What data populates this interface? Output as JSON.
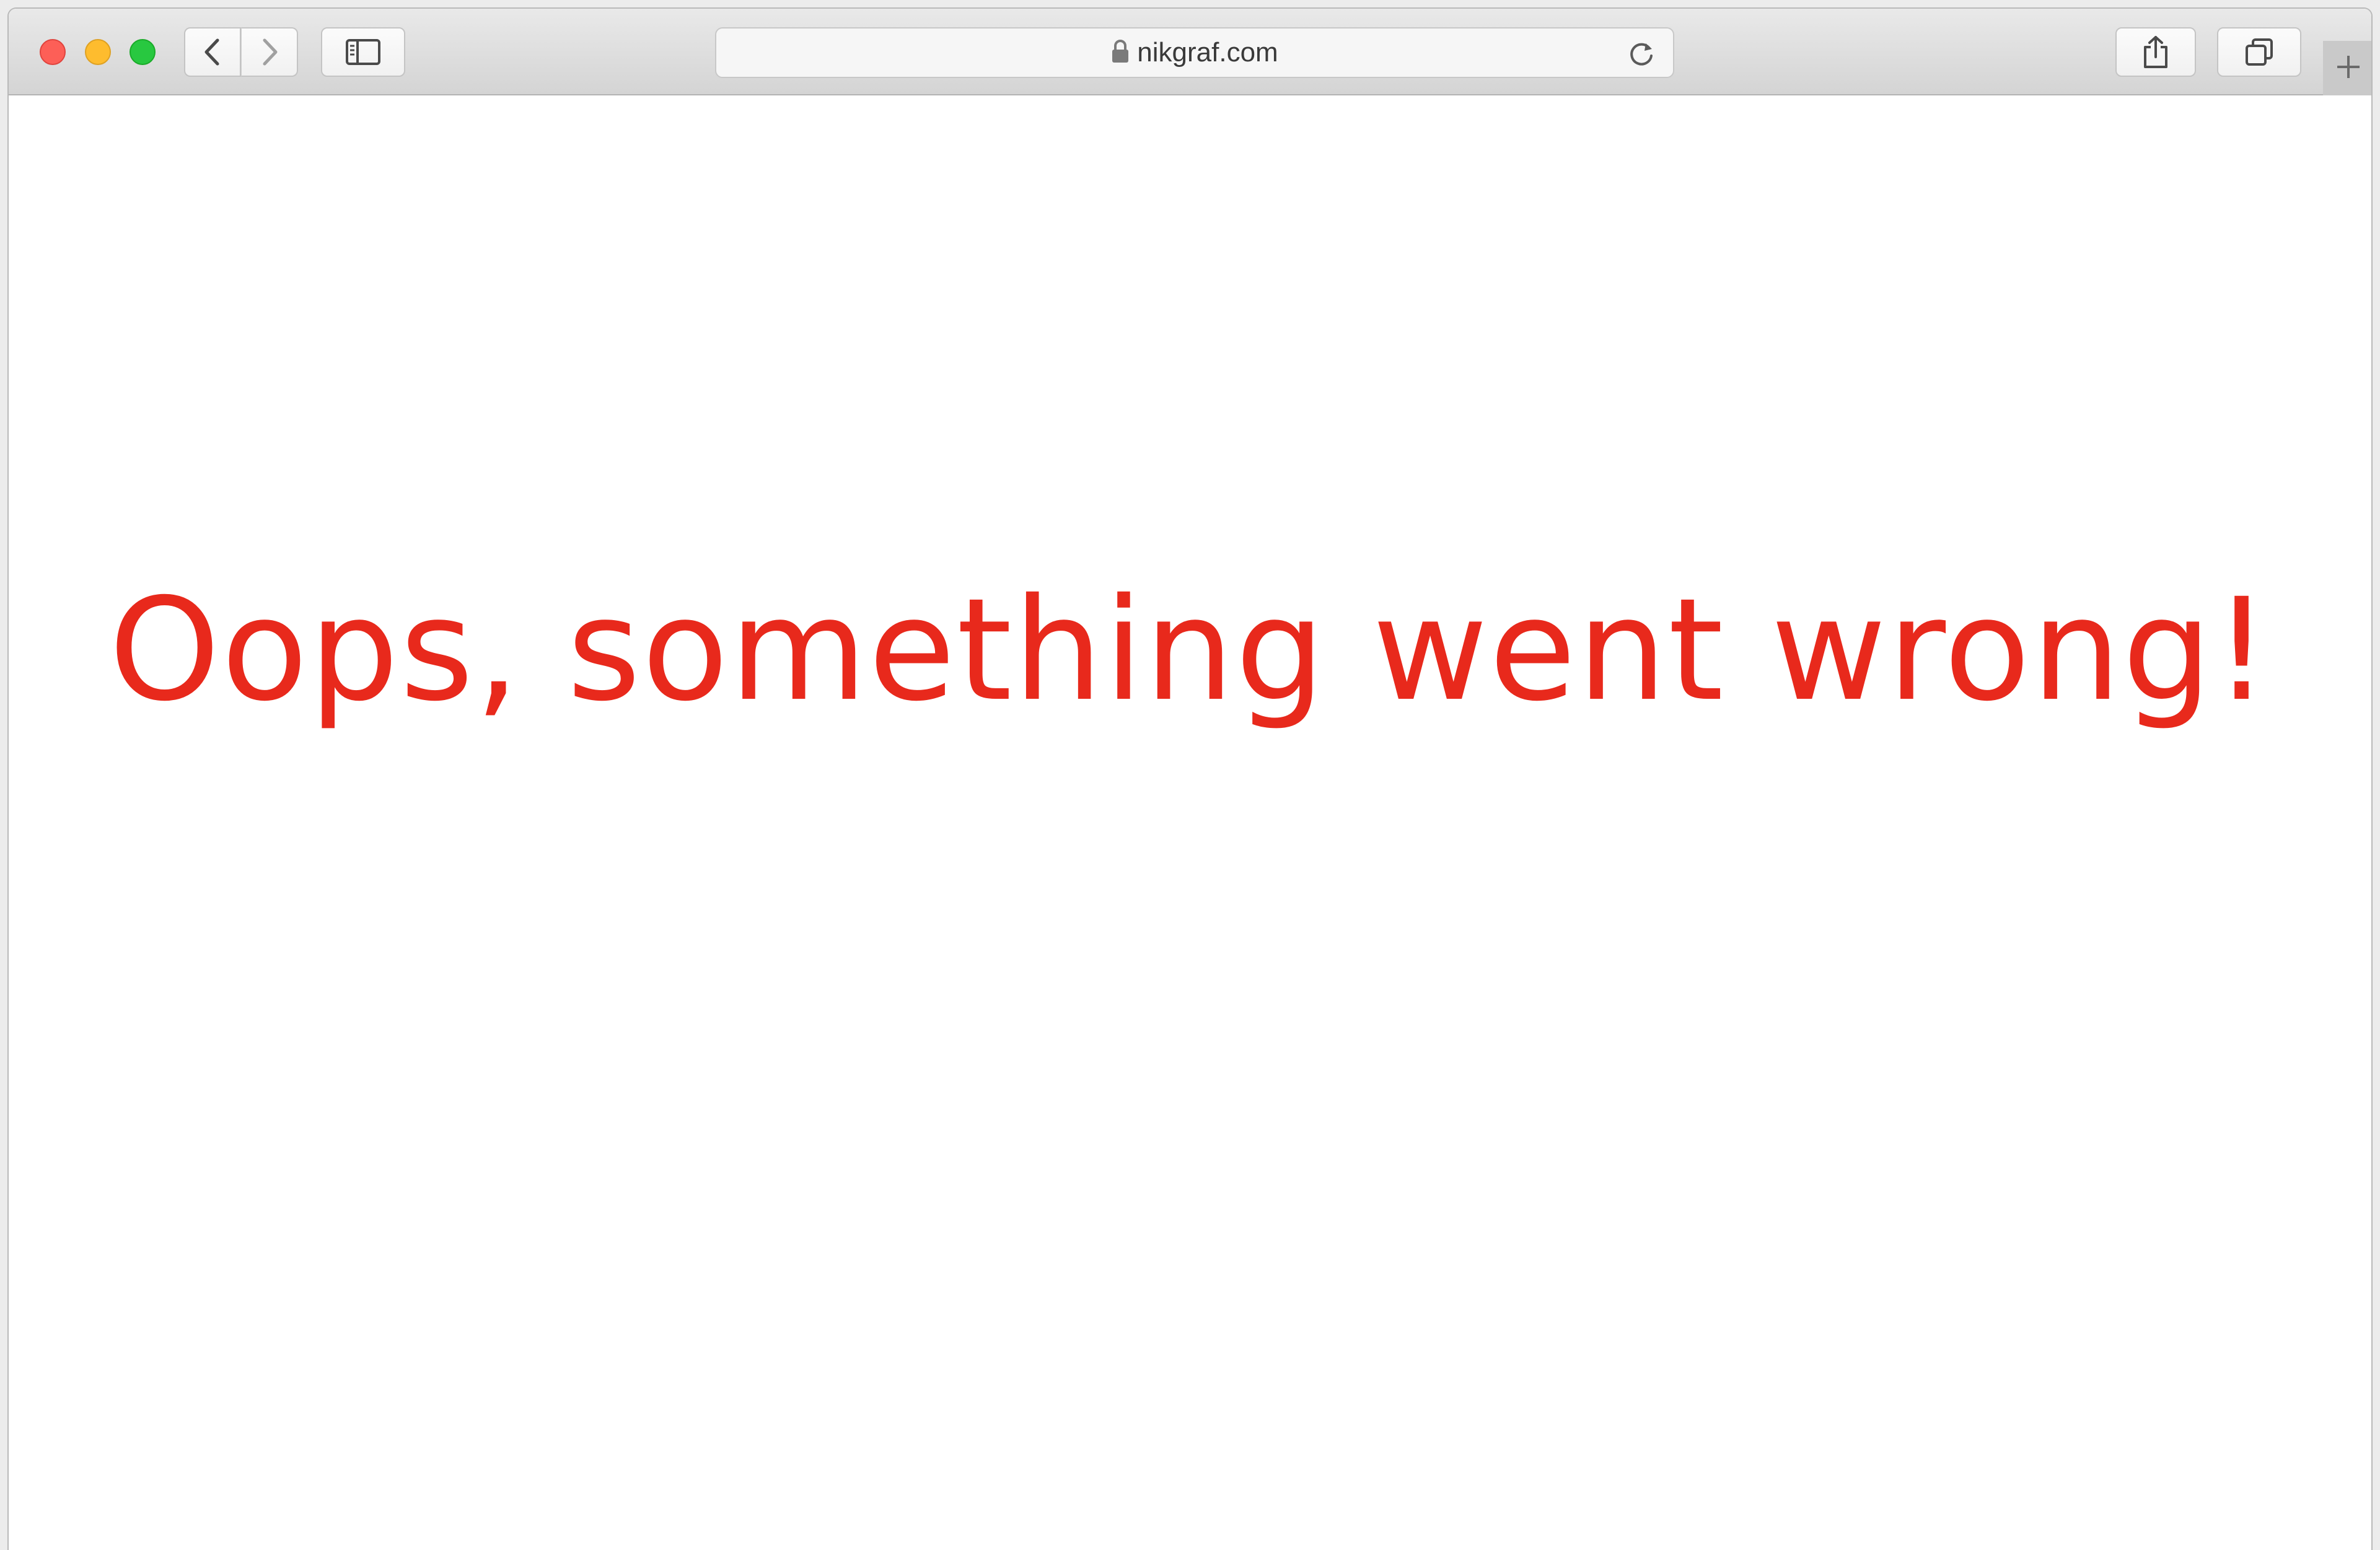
{
  "browser": {
    "address": {
      "url": "nikgraf.com",
      "secure": true
    },
    "icons": {
      "back": "chevron-left-icon",
      "forward": "chevron-right-icon",
      "sidebar": "sidebar-icon",
      "lock": "lock-icon",
      "reload": "reload-icon",
      "share": "share-icon",
      "tabs": "tabs-overview-icon",
      "new_tab": "plus-icon"
    },
    "colors": {
      "close": "#fd5f57",
      "minimize": "#febc2e",
      "zoom": "#28c840"
    }
  },
  "page": {
    "message": "Oops, something went wrong!",
    "message_color": "#e8291c"
  }
}
